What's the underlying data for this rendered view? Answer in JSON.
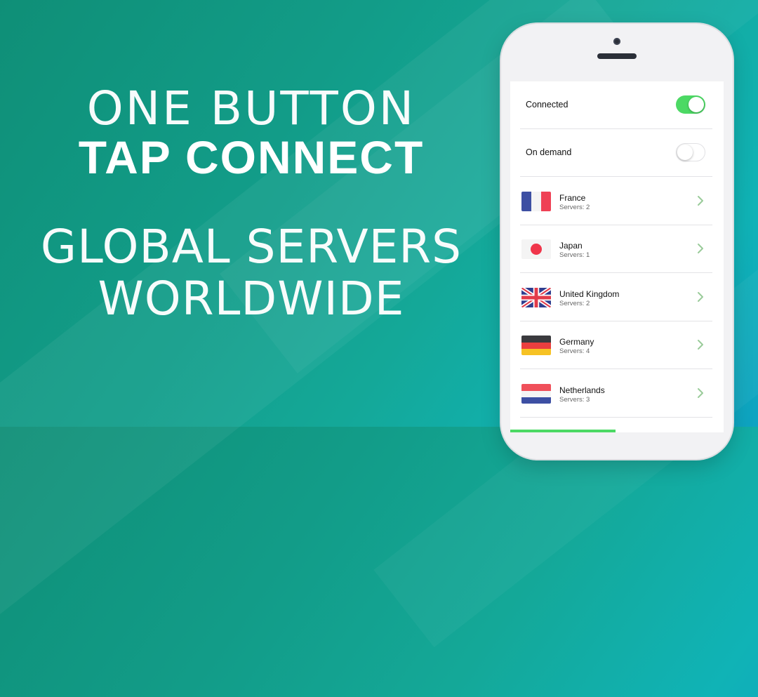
{
  "headline": {
    "line1": "ONE BUTTON",
    "line2": "TAP CONNECT",
    "line3": "GLOBAL SERVERS",
    "line4": "WORLDWIDE"
  },
  "settings": {
    "connected_label": "Connected",
    "connected_state": true,
    "on_demand_label": "On demand",
    "on_demand_state": false
  },
  "servers_list": [
    {
      "country": "France",
      "servers": "Servers: 2",
      "flag": "france-flag-icon"
    },
    {
      "country": "Japan",
      "servers": "Servers: 1",
      "flag": "japan-flag-icon"
    },
    {
      "country": "United Kingdom",
      "servers": "Servers: 2",
      "flag": "uk-flag-icon"
    },
    {
      "country": "Germany",
      "servers": "Servers: 4",
      "flag": "germany-flag-icon"
    },
    {
      "country": "Netherlands",
      "servers": "Servers: 3",
      "flag": "netherlands-flag-icon"
    }
  ],
  "colors": {
    "accent": "#4cd964",
    "background_start": "#0f8f77",
    "background_end": "#0ea3c2",
    "chevron": "#9acb9a"
  },
  "icons": {
    "chevron": "chevron-right-icon"
  }
}
